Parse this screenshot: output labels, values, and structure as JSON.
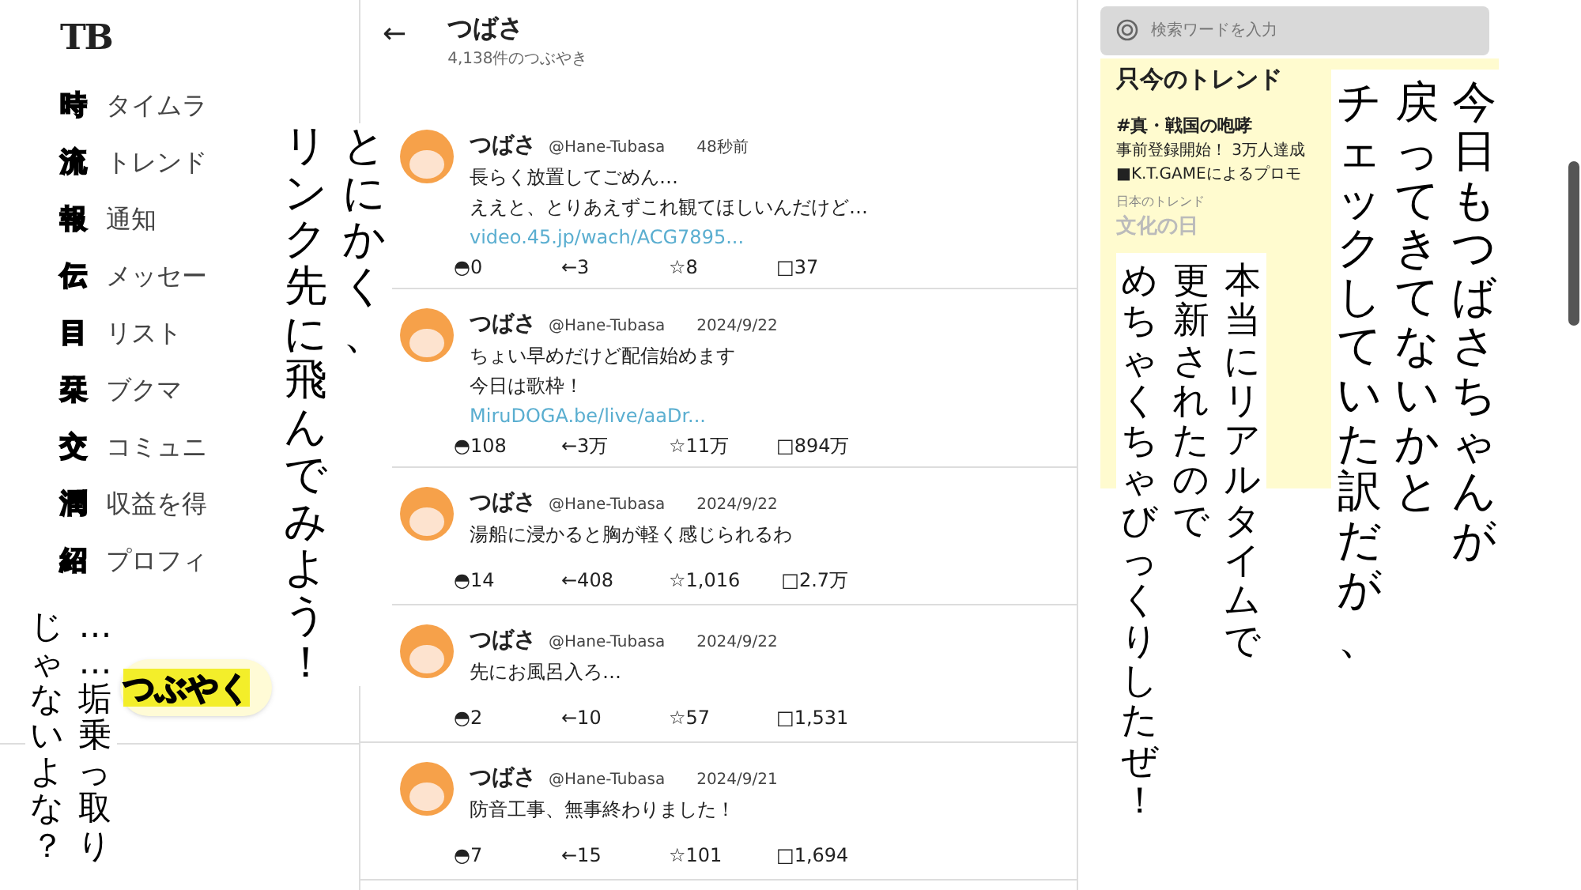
{
  "sidebar": {
    "logo": "TB",
    "items": [
      {
        "glyph": "時",
        "label": "タイムラ"
      },
      {
        "glyph": "流",
        "label": "トレンド"
      },
      {
        "glyph": "報",
        "label": "通知"
      },
      {
        "glyph": "伝",
        "label": "メッセー"
      },
      {
        "glyph": "目",
        "label": "リスト"
      },
      {
        "glyph": "栞",
        "label": "ブクマ"
      },
      {
        "glyph": "交",
        "label": "コミュニ"
      },
      {
        "glyph": "潤",
        "label": "収益を得"
      },
      {
        "glyph": "紹",
        "label": "プロフィ"
      }
    ],
    "post_button": "つぶやく"
  },
  "profile_header": {
    "back": "←",
    "name": "つばさ",
    "count": "4,138件のつぶやき"
  },
  "posts": [
    {
      "name": "つばさ",
      "handle": "@Hane-Tubasa",
      "time": "48秒前",
      "lines": [
        "長らく放置してごめん…",
        "ええと、とりあえずこれ観てほしいんだけど…"
      ],
      "link": "video.45.jp/wach/ACG7895...",
      "stats": [
        "◓0",
        "←3",
        "☆8",
        "□37"
      ]
    },
    {
      "name": "つばさ",
      "handle": "@Hane-Tubasa",
      "time": "2024/9/22",
      "lines": [
        "ちょい早めだけど配信始めます",
        "今日は歌枠！"
      ],
      "link": "MiruDOGA.be/live/aaDr...",
      "stats": [
        "◓108",
        "←3万",
        "☆11万",
        "□894万"
      ]
    },
    {
      "name": "つばさ",
      "handle": "@Hane-Tubasa",
      "time": "2024/9/22",
      "lines": [
        "湯船に浸かると胸が軽く感じられるわ"
      ],
      "stats": [
        "◓14",
        "←408",
        "☆1,016",
        "□2.7万"
      ]
    },
    {
      "name": "つばさ",
      "handle": "@Hane-Tubasa",
      "time": "2024/9/22",
      "lines": [
        "先にお風呂入ろ…"
      ],
      "stats": [
        "◓2",
        "←10",
        "☆57",
        "□1,531"
      ]
    },
    {
      "name": "つばさ",
      "handle": "@Hane-Tubasa",
      "time": "2024/9/21",
      "lines": [
        "防音工事、無事終わりました！"
      ],
      "stats": [
        "◓7",
        "←15",
        "☆101",
        "□1,694"
      ]
    }
  ],
  "search": {
    "placeholder": "検索ワードを入力"
  },
  "trends": {
    "title": "只今のトレンド",
    "promoted_tag": "#真・戦国の咆哮",
    "promoted_lines": [
      "事前登録開始！ 3万人達成",
      "■K.T.GAMEによるプロモ"
    ],
    "section": "日本のトレンド",
    "items": [
      "文化の日"
    ]
  },
  "captions": [
    {
      "columns": [
        "リンク先に飛んでみよう！",
        "とにかく、"
      ]
    },
    {
      "columns": [
        "じゃないよな？",
        "……垢乗っ取り"
      ]
    },
    {
      "columns": [
        "チェックしていた訳だが、",
        "戻ってきてないかと",
        "今日もつばさちゃんが"
      ]
    },
    {
      "columns": [
        "めちゃくちゃびっくりしたぜ！",
        "更新されたので",
        "本当にリアルタイムで"
      ]
    }
  ]
}
